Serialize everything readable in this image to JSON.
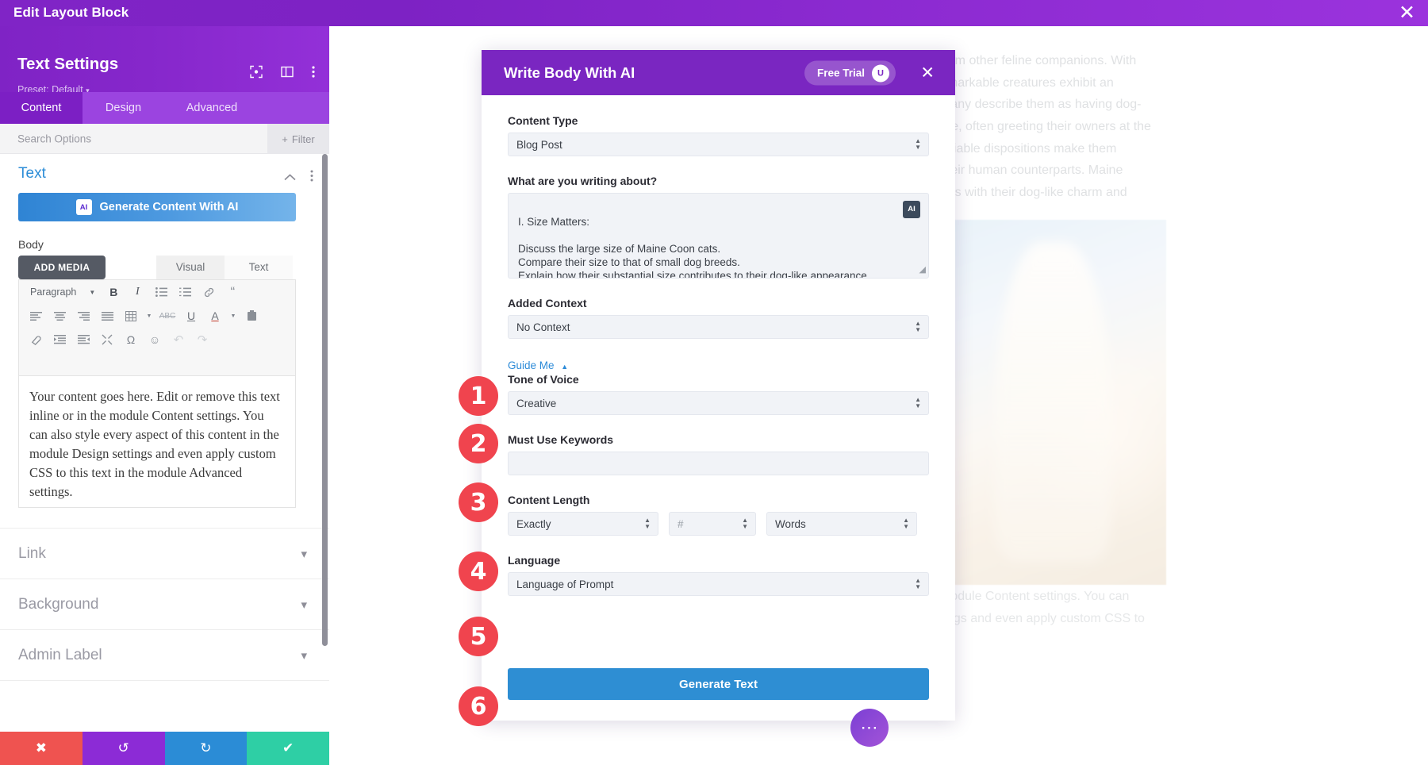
{
  "topbar": {
    "title": "Edit Layout Block",
    "close_icon": "close-icon"
  },
  "left_panel": {
    "title": "Text Settings",
    "preset": "Preset: Default",
    "preset_caret": "▾",
    "header_icons": [
      "focus-icon",
      "layout-columns-icon",
      "kebab-menu-icon"
    ],
    "tabs": [
      {
        "label": "Content",
        "active": true
      },
      {
        "label": "Design",
        "active": false
      },
      {
        "label": "Advanced",
        "active": false
      }
    ],
    "search_placeholder": "Search Options",
    "filter_label": "Filter",
    "filter_plus": "+",
    "section": {
      "title": "Text",
      "collapse_icon": "chevron-up-icon",
      "menu_icon": "kebab-menu-icon"
    },
    "generate_ai_button": {
      "label": "Generate Content With AI",
      "chip": "AI"
    },
    "body_label": "Body",
    "add_media_label": "ADD MEDIA",
    "editor_tabs": [
      {
        "label": "Visual",
        "active": true
      },
      {
        "label": "Text",
        "active": false
      }
    ],
    "toolbar": {
      "format_select": "Paragraph",
      "row1": [
        "bold-icon",
        "italic-icon",
        "bulleted-list-icon",
        "numbered-list-icon",
        "link-icon",
        "blockquote-icon"
      ],
      "row2": [
        "align-left-icon",
        "align-center-icon",
        "align-right-icon",
        "align-justify-icon",
        "table-icon",
        "strikethrough-icon",
        "underline-icon",
        "text-color-icon",
        "paste-as-text-icon"
      ],
      "row3": [
        "clear-formatting-icon",
        "decrease-indent-icon",
        "increase-indent-icon",
        "insert-more-icon",
        "special-character-icon",
        "emoji-icon",
        "undo-icon",
        "redo-icon"
      ]
    },
    "content_text": "Your content goes here. Edit or remove this text inline or in the module Content settings. You can also style every aspect of this content in the module Design settings and even apply custom CSS to this text in the module Advanced settings.",
    "accordions": [
      {
        "label": "Link",
        "chevron": "chevron-down-icon"
      },
      {
        "label": "Background",
        "chevron": "chevron-down-icon"
      },
      {
        "label": "Admin Label",
        "chevron": "chevron-down-icon"
      }
    ],
    "actions": [
      {
        "name": "cancel",
        "icon": "✖",
        "color": "#ef5350"
      },
      {
        "name": "undo",
        "icon": "↺",
        "color": "#8c2bd6"
      },
      {
        "name": "redo",
        "icon": "↻",
        "color": "#2b8cd6"
      },
      {
        "name": "save",
        "icon": "✔",
        "color": "#2ecfa5"
      }
    ]
  },
  "canvas": {
    "page_text_top": "from other feline companions. With\nemarkable creatures exhibit an\nmany describe them as having dog-\nure, often greeting their owners at the\nociable dispositions make them\ntheir human counterparts. Maine\narts with their dog-like charm and",
    "page_text_bottom": "module Content settings. You can\ntings and even apply custom CSS to"
  },
  "modal": {
    "title": "Write Body With AI",
    "free_trial": {
      "label": "Free Trial",
      "knob": "U"
    },
    "close_icon": "close-icon",
    "fields": {
      "content_type": {
        "label": "Content Type",
        "value": "Blog Post"
      },
      "prompt": {
        "label": "What are you writing about?",
        "value": "I. Size Matters:\n\nDiscuss the large size of Maine Coon cats.\nCompare their size to that of small dog breeds.\nExplain how their substantial size contributes to their dog-like appearance.",
        "ai_chip": "AI"
      },
      "added_context": {
        "label": "Added Context",
        "value": "No Context"
      },
      "guide_me": {
        "label": "Guide Me",
        "triangle": "▲"
      },
      "tone": {
        "label": "Tone of Voice",
        "value": "Creative"
      },
      "keywords": {
        "label": "Must Use Keywords",
        "value": "",
        "placeholder": ""
      },
      "content_length": {
        "label": "Content Length",
        "mode": "Exactly",
        "amount_placeholder": "#",
        "unit": "Words"
      },
      "language": {
        "label": "Language",
        "value": "Language of Prompt"
      }
    },
    "generate_button": "Generate Text",
    "fab_icon": "more-options-icon"
  },
  "annotations": [
    {
      "number": "1"
    },
    {
      "number": "2"
    },
    {
      "number": "3"
    },
    {
      "number": "4"
    },
    {
      "number": "5"
    },
    {
      "number": "6"
    }
  ],
  "colors": {
    "brand_purple": "#7a26c1",
    "accent_blue": "#2e8ed3",
    "badge_red": "#f0444e",
    "save_green": "#2ecfa5"
  }
}
